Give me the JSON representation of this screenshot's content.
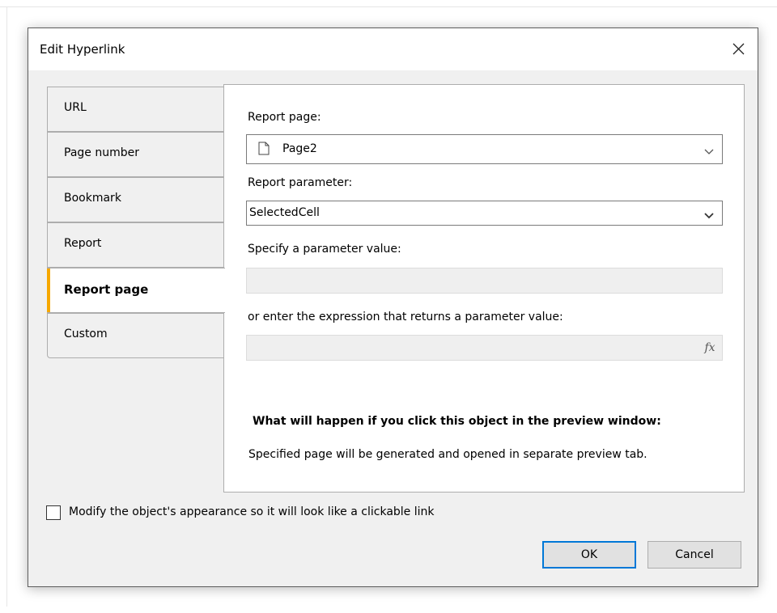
{
  "dialog": {
    "title": "Edit Hyperlink",
    "close_icon": "close-icon"
  },
  "tabs": [
    {
      "label": "URL",
      "active": false
    },
    {
      "label": "Page number",
      "active": false
    },
    {
      "label": "Bookmark",
      "active": false
    },
    {
      "label": "Report",
      "active": false
    },
    {
      "label": "Report page",
      "active": true
    },
    {
      "label": "Custom",
      "active": false
    }
  ],
  "form": {
    "report_page_label": "Report page:",
    "report_page_value": "Page2",
    "report_page_icon": "page-icon",
    "report_parameter_label": "Report parameter:",
    "report_parameter_value": "SelectedCell",
    "param_value_label": "Specify a parameter value:",
    "param_value": "",
    "expression_label": "or enter the expression that returns a parameter value:",
    "expression_value": "",
    "fx_label": "fx"
  },
  "note": {
    "heading": "What will happen if you click this object in the preview window:",
    "body": "Specified page will be generated and opened in separate preview tab."
  },
  "options": {
    "modify_appearance_label": "Modify the object's appearance so it will look like a clickable link",
    "modify_appearance_checked": false
  },
  "buttons": {
    "ok": "OK",
    "cancel": "Cancel"
  },
  "colors": {
    "active_tab_accent": "#f6a800",
    "default_button_border": "#0078d7"
  }
}
